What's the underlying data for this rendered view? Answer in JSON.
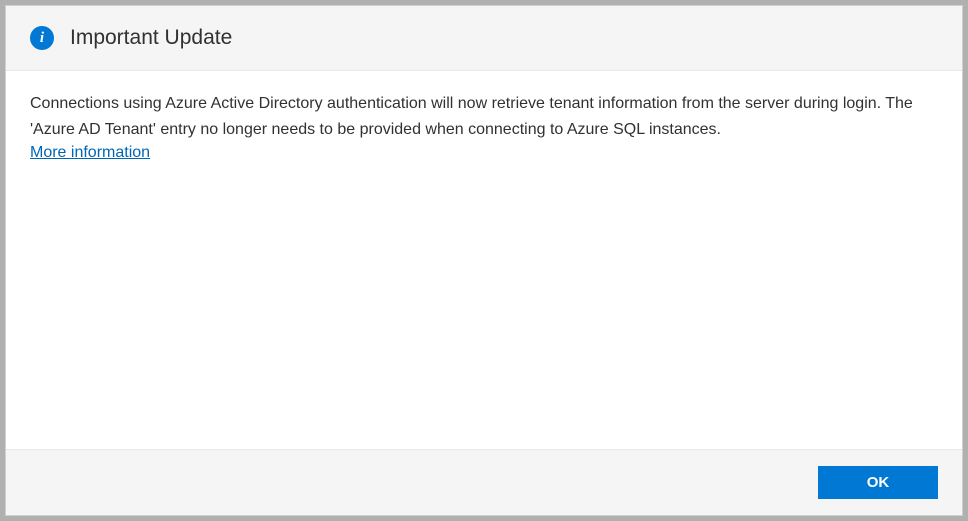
{
  "dialog": {
    "title": "Important Update",
    "message": "Connections using Azure Active Directory authentication will now retrieve tenant information from the server during login. The 'Azure AD Tenant' entry no longer needs to be provided when connecting to Azure SQL instances.",
    "link_label": "More information",
    "ok_label": "OK",
    "info_glyph": "i"
  }
}
